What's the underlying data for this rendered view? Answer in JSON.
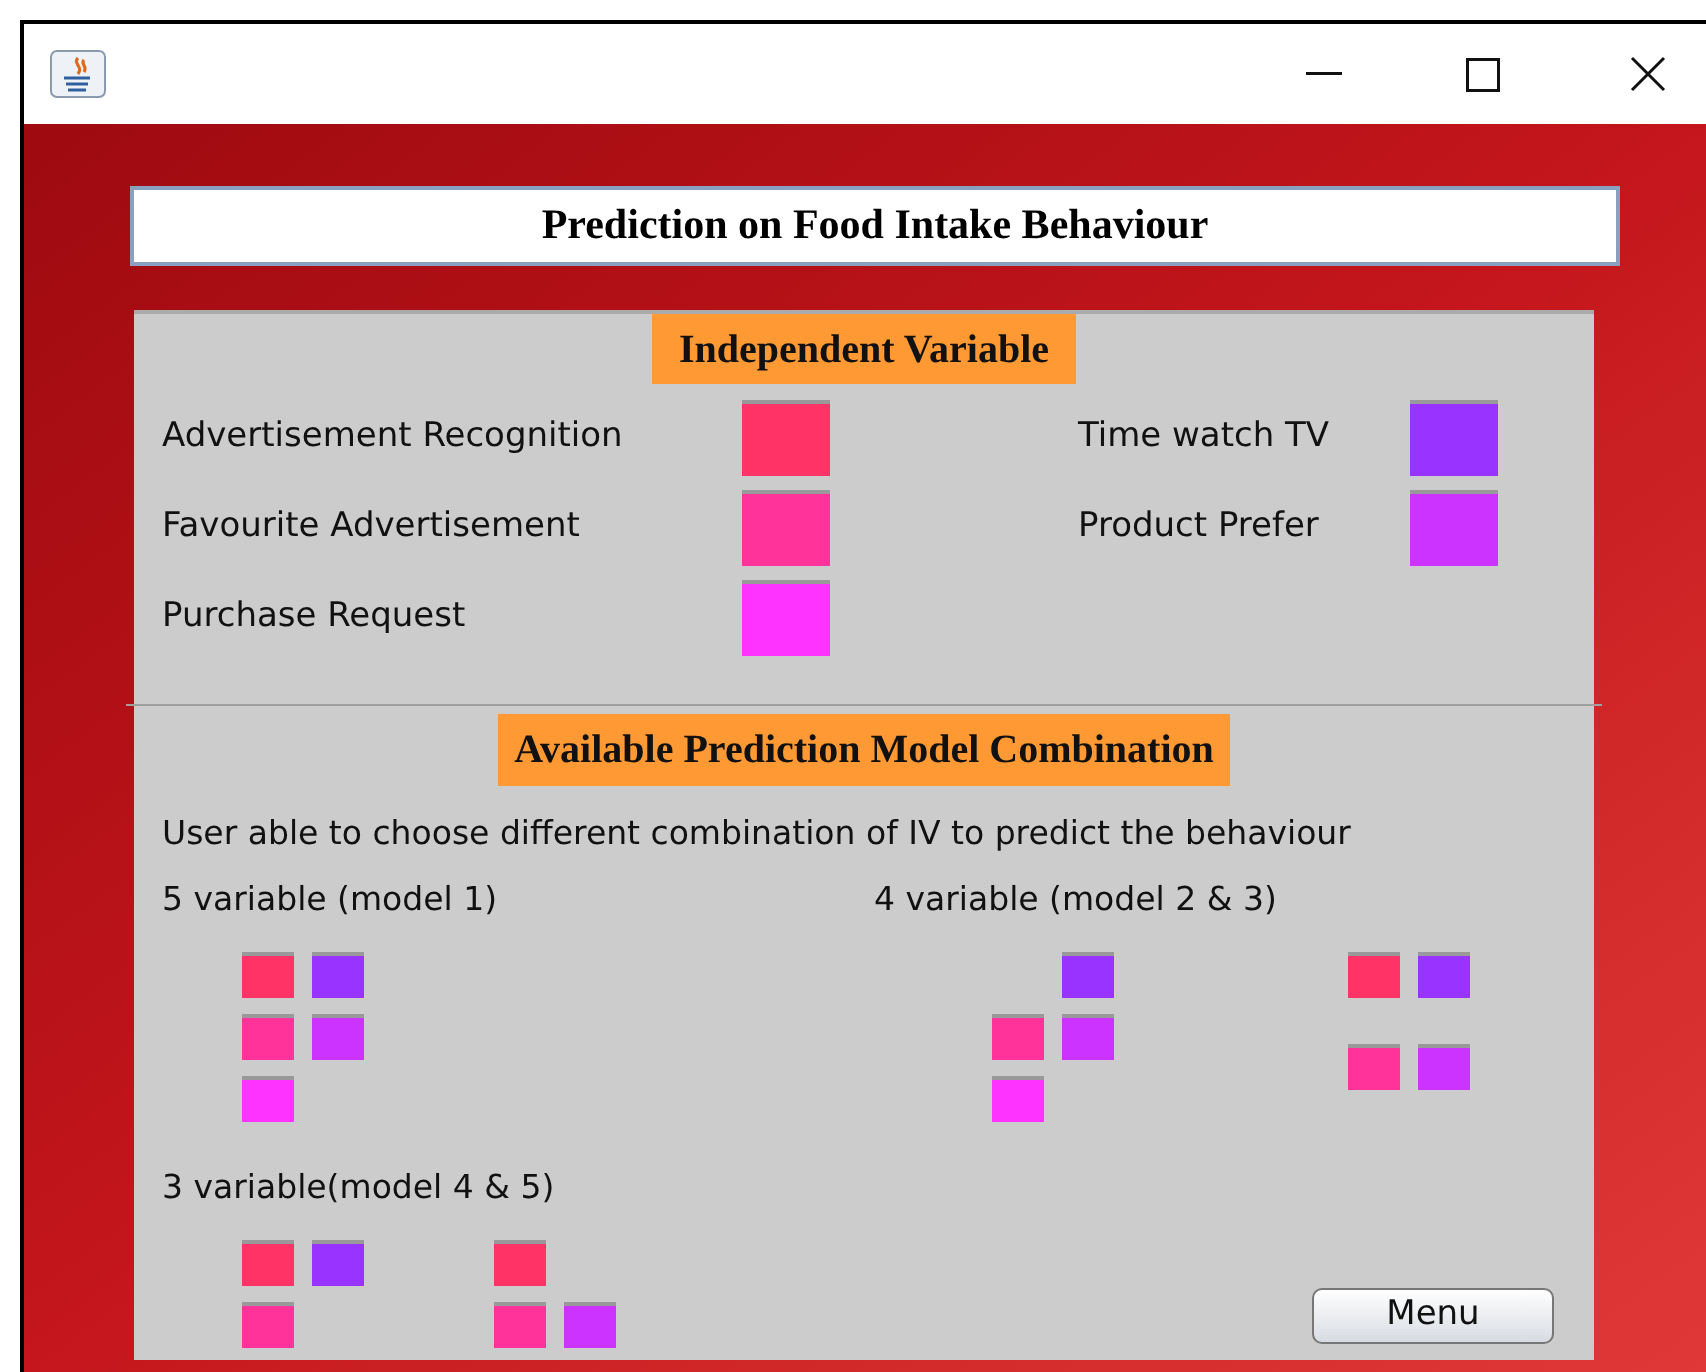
{
  "window": {
    "title": "Prediction on Food Intake Behaviour"
  },
  "independent": {
    "heading": "Independent Variable",
    "columns": [
      [
        {
          "label": "Advertisement Recognition",
          "color": "#ff3366"
        },
        {
          "label": "Favourite Advertisement",
          "color": "#ff3399"
        },
        {
          "label": "Purchase Request",
          "color": "#ff33ff"
        }
      ],
      [
        {
          "label": "Time watch TV",
          "color": "#9933ff"
        },
        {
          "label": "Product Prefer",
          "color": "#cc33ff"
        }
      ]
    ]
  },
  "models": {
    "heading": "Available Prediction Model Combination",
    "description": "User able to choose different combination of IV to predict the behaviour",
    "groups": [
      {
        "label": "5 variable (model 1)",
        "models": [
          {
            "rows": [
              [
                {
                  "kind": "square",
                  "color": "#ff3366"
                },
                {
                  "kind": "square",
                  "color": "#9933ff"
                }
              ],
              [
                {
                  "kind": "square",
                  "color": "#ff3399"
                },
                {
                  "kind": "square",
                  "color": "#cc33ff"
                }
              ],
              [
                {
                  "kind": "square",
                  "color": "#ff33ff"
                },
                {
                  "kind": "blank"
                }
              ]
            ]
          }
        ]
      },
      {
        "label": "4 variable (model 2 & 3)",
        "models": [
          {
            "rows": [
              [
                {
                  "kind": "blank"
                },
                {
                  "kind": "square",
                  "color": "#9933ff"
                }
              ],
              [
                {
                  "kind": "square",
                  "color": "#ff3399"
                },
                {
                  "kind": "square",
                  "color": "#cc33ff"
                }
              ],
              [
                {
                  "kind": "square",
                  "color": "#ff33ff"
                },
                {
                  "kind": "blank"
                }
              ]
            ]
          },
          {
            "rows": [
              [
                {
                  "kind": "square",
                  "color": "#ff3366"
                },
                {
                  "kind": "square",
                  "color": "#9933ff"
                }
              ],
              [
                {
                  "kind": "square",
                  "color": "#ff3399"
                },
                {
                  "kind": "square",
                  "color": "#cc33ff"
                }
              ]
            ]
          }
        ]
      },
      {
        "label": "3 variable(model 4 & 5)",
        "models": [
          {
            "rows": [
              [
                {
                  "kind": "square",
                  "color": "#ff3366"
                },
                {
                  "kind": "square",
                  "color": "#9933ff"
                }
              ],
              [
                {
                  "kind": "square",
                  "color": "#ff3399"
                },
                {
                  "kind": "blank"
                }
              ]
            ]
          },
          {
            "rows": [
              [
                {
                  "kind": "square",
                  "color": "#ff3366"
                },
                {
                  "kind": "blank"
                }
              ],
              [
                {
                  "kind": "square",
                  "color": "#ff3399"
                },
                {
                  "kind": "square",
                  "color": "#cc33ff"
                }
              ]
            ]
          }
        ]
      }
    ]
  },
  "buttons": [
    "Menu"
  ]
}
